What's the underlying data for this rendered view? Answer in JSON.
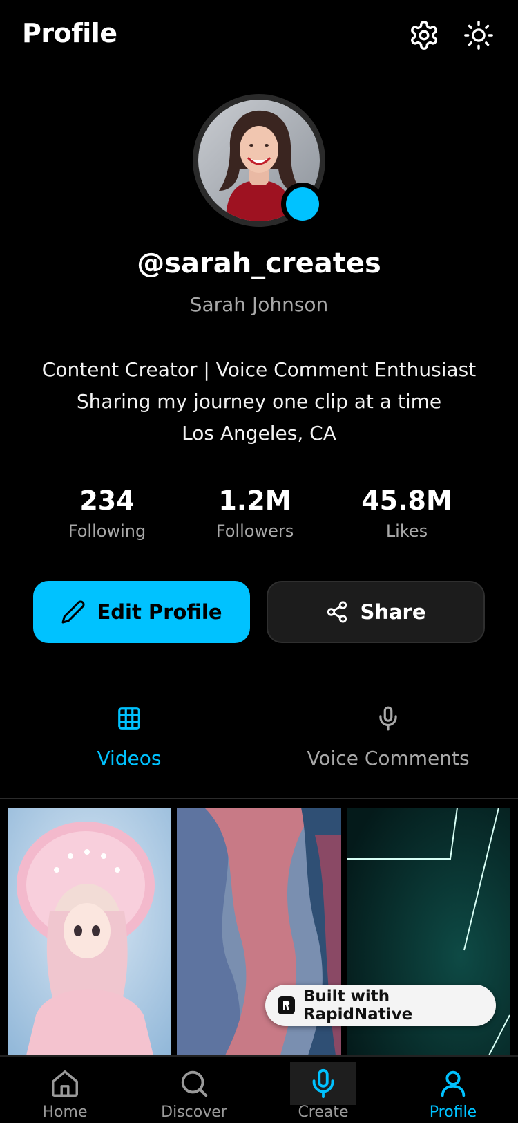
{
  "header": {
    "title": "Profile",
    "settings_icon": "gear-icon",
    "theme_icon": "sun-icon"
  },
  "profile": {
    "username": "@sarah_creates",
    "full_name": "Sarah Johnson",
    "bio": [
      "Content Creator | Voice Comment Enthusiast",
      "Sharing my journey one clip at a time",
      "Los Angeles, CA"
    ],
    "online_status_color": "#00C2FF"
  },
  "stats": [
    {
      "value": "234",
      "label": "Following"
    },
    {
      "value": "1.2M",
      "label": "Followers"
    },
    {
      "value": "45.8M",
      "label": "Likes"
    }
  ],
  "actions": {
    "edit_label": "Edit Profile",
    "share_label": "Share"
  },
  "tabs": [
    {
      "label": "Videos",
      "icon": "grid-icon",
      "active": true
    },
    {
      "label": "Voice Comments",
      "icon": "microphone-icon",
      "active": false
    }
  ],
  "videos": [
    {
      "subject": "doll in pink bonnet"
    },
    {
      "subject": "abstract pink and blue waves"
    },
    {
      "subject": "dark teal neon lines"
    }
  ],
  "badge": {
    "label": "Built with RapidNative"
  },
  "bottom_nav": [
    {
      "label": "Home",
      "icon": "home-icon"
    },
    {
      "label": "Discover",
      "icon": "search-icon"
    },
    {
      "label": "Create",
      "icon": "microphone-icon"
    },
    {
      "label": "Profile",
      "icon": "user-icon",
      "active": true
    }
  ],
  "colors": {
    "accent": "#00C2FF",
    "background": "#000000",
    "muted": "#A8A8A8",
    "card": "#1C1C1C"
  }
}
